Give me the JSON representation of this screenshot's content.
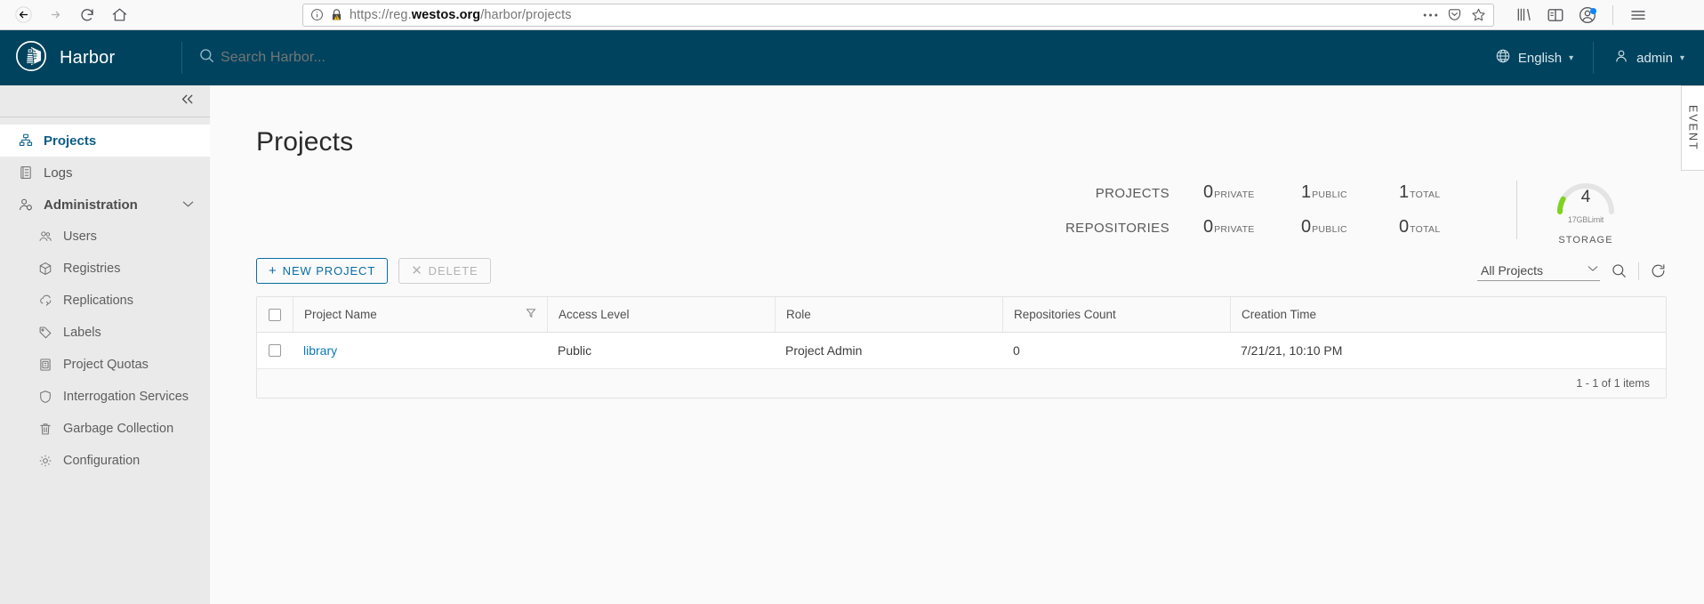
{
  "browser": {
    "back_icon": "back-arrow-icon",
    "forward_icon": "forward-arrow-icon",
    "reload_icon": "reload-icon",
    "home_icon": "home-icon",
    "url_scheme": "https://reg.",
    "url_domain": "westos.org",
    "url_path": "/harbor/projects",
    "url_full": "https://reg.westos.org/harbor/projects",
    "page_info_icon": "info-circle-icon",
    "security_icon": "lock-warning-icon",
    "page_actions_icon": "ellipsis-icon",
    "pocket_icon": "pocket-icon",
    "bookmark_icon": "star-icon",
    "library_icon": "library-icon",
    "sidebar_icon": "sidebar-icon",
    "account_icon": "account-icon",
    "menu_icon": "hamburger-menu-icon"
  },
  "header": {
    "logo_icon": "harbor-lighthouse-logo",
    "brand": "Harbor",
    "search_placeholder": "Search Harbor...",
    "search_value": "",
    "search_icon": "search-icon",
    "language_icon": "globe-icon",
    "language": "English",
    "user_icon": "user-icon",
    "user": "admin",
    "caret": "⌄",
    "bg_color": "#00435e"
  },
  "sidebar": {
    "collapse_icon": "double-chevron-left-icon",
    "items": [
      {
        "label": "Projects",
        "icon": "projects-icon",
        "active": true,
        "level": "top"
      },
      {
        "label": "Logs",
        "icon": "logs-icon",
        "active": false,
        "level": "top"
      },
      {
        "label": "Administration",
        "icon": "administration-icon",
        "active": false,
        "level": "group",
        "expanded": true
      },
      {
        "label": "Users",
        "icon": "users-icon",
        "active": false,
        "level": "sub"
      },
      {
        "label": "Registries",
        "icon": "registries-icon",
        "active": false,
        "level": "sub"
      },
      {
        "label": "Replications",
        "icon": "replications-icon",
        "active": false,
        "level": "sub"
      },
      {
        "label": "Labels",
        "icon": "labels-icon",
        "active": false,
        "level": "sub"
      },
      {
        "label": "Project Quotas",
        "icon": "project-quotas-icon",
        "active": false,
        "level": "sub"
      },
      {
        "label": "Interrogation Services",
        "icon": "interrogation-services-icon",
        "active": false,
        "level": "sub"
      },
      {
        "label": "Garbage Collection",
        "icon": "garbage-collection-icon",
        "active": false,
        "level": "sub"
      },
      {
        "label": "Configuration",
        "icon": "configuration-icon",
        "active": false,
        "level": "sub"
      }
    ]
  },
  "main": {
    "title": "Projects",
    "statistics": {
      "rows": [
        {
          "label": "PROJECTS",
          "cells": [
            {
              "value": "0",
              "unit": "PRIVATE"
            },
            {
              "value": "1",
              "unit": "PUBLIC"
            },
            {
              "value": "1",
              "unit": "TOTAL"
            }
          ]
        },
        {
          "label": "REPOSITORIES",
          "cells": [
            {
              "value": "0",
              "unit": "PRIVATE"
            },
            {
              "value": "0",
              "unit": "PUBLIC"
            },
            {
              "value": "0",
              "unit": "TOTAL"
            }
          ]
        }
      ],
      "storage": {
        "value": "4",
        "limit": "17GBLimit",
        "label": "STORAGE",
        "gauge_percent": 18,
        "gauge_color": "#7ed321",
        "gauge_track_color": "#e4e4e4"
      }
    },
    "toolbar": {
      "new_project_label": "NEW PROJECT",
      "new_project_icon": "plus-icon",
      "delete_label": "DELETE",
      "delete_icon": "close-x-icon",
      "delete_disabled": true,
      "filter_value": "All Projects",
      "filter_caret": "⌄",
      "search_icon": "search-icon",
      "refresh_icon": "refresh-icon"
    },
    "table": {
      "select_all_checkbox": false,
      "columns": [
        "Project Name",
        "Access Level",
        "Role",
        "Repositories Count",
        "Creation Time"
      ],
      "name_filter_icon": "filter-icon",
      "rows": [
        {
          "checked": false,
          "name": "library",
          "access_level": "Public",
          "role": "Project Admin",
          "repositories_count": "0",
          "creation_time": "7/21/21, 10:10 PM"
        }
      ],
      "footer": "1 - 1 of 1 items"
    },
    "event_tab": "EVENT"
  }
}
